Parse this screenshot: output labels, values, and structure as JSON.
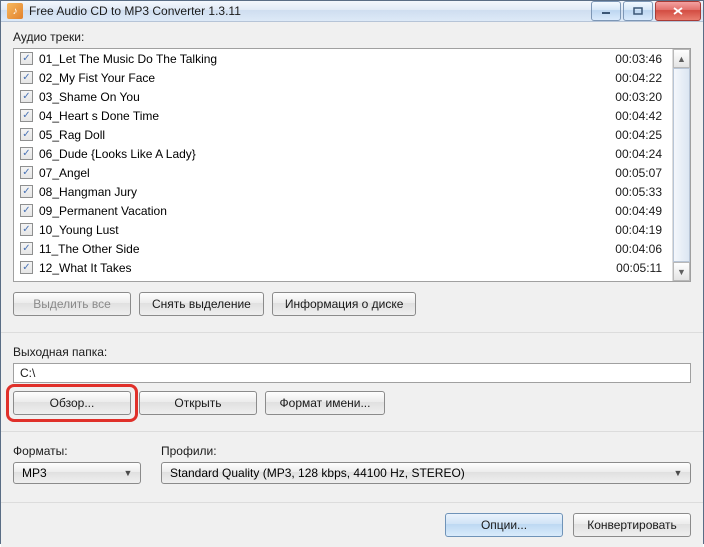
{
  "window": {
    "title": "Free Audio CD to MP3 Converter 1.3.11"
  },
  "labels": {
    "audio_tracks": "Аудио треки:",
    "output_folder": "Выходная папка:",
    "formats": "Форматы:",
    "profiles": "Профили:"
  },
  "tracks": [
    {
      "name": "01_Let The Music Do The Talking",
      "time": "00:03:46"
    },
    {
      "name": "02_My Fist Your Face",
      "time": "00:04:22"
    },
    {
      "name": "03_Shame On You",
      "time": "00:03:20"
    },
    {
      "name": "04_Heart s Done Time",
      "time": "00:04:42"
    },
    {
      "name": "05_Rag Doll",
      "time": "00:04:25"
    },
    {
      "name": "06_Dude {Looks Like A Lady}",
      "time": "00:04:24"
    },
    {
      "name": "07_Angel",
      "time": "00:05:07"
    },
    {
      "name": "08_Hangman Jury",
      "time": "00:05:33"
    },
    {
      "name": "09_Permanent Vacation",
      "time": "00:04:49"
    },
    {
      "name": "10_Young Lust",
      "time": "00:04:19"
    },
    {
      "name": "11_The Other Side",
      "time": "00:04:06"
    },
    {
      "name": "12_What It Takes",
      "time": "00:05:11"
    }
  ],
  "buttons": {
    "select_all": "Выделить все",
    "deselect": "Снять выделение",
    "disc_info": "Информация о диске",
    "browse": "Обзор...",
    "open": "Открыть",
    "name_format": "Формат имени...",
    "options": "Опции...",
    "convert": "Конвертировать"
  },
  "output_path": "C:\\",
  "format_value": "MP3",
  "profile_value": "Standard Quality (MP3, 128 kbps, 44100 Hz, STEREO)"
}
